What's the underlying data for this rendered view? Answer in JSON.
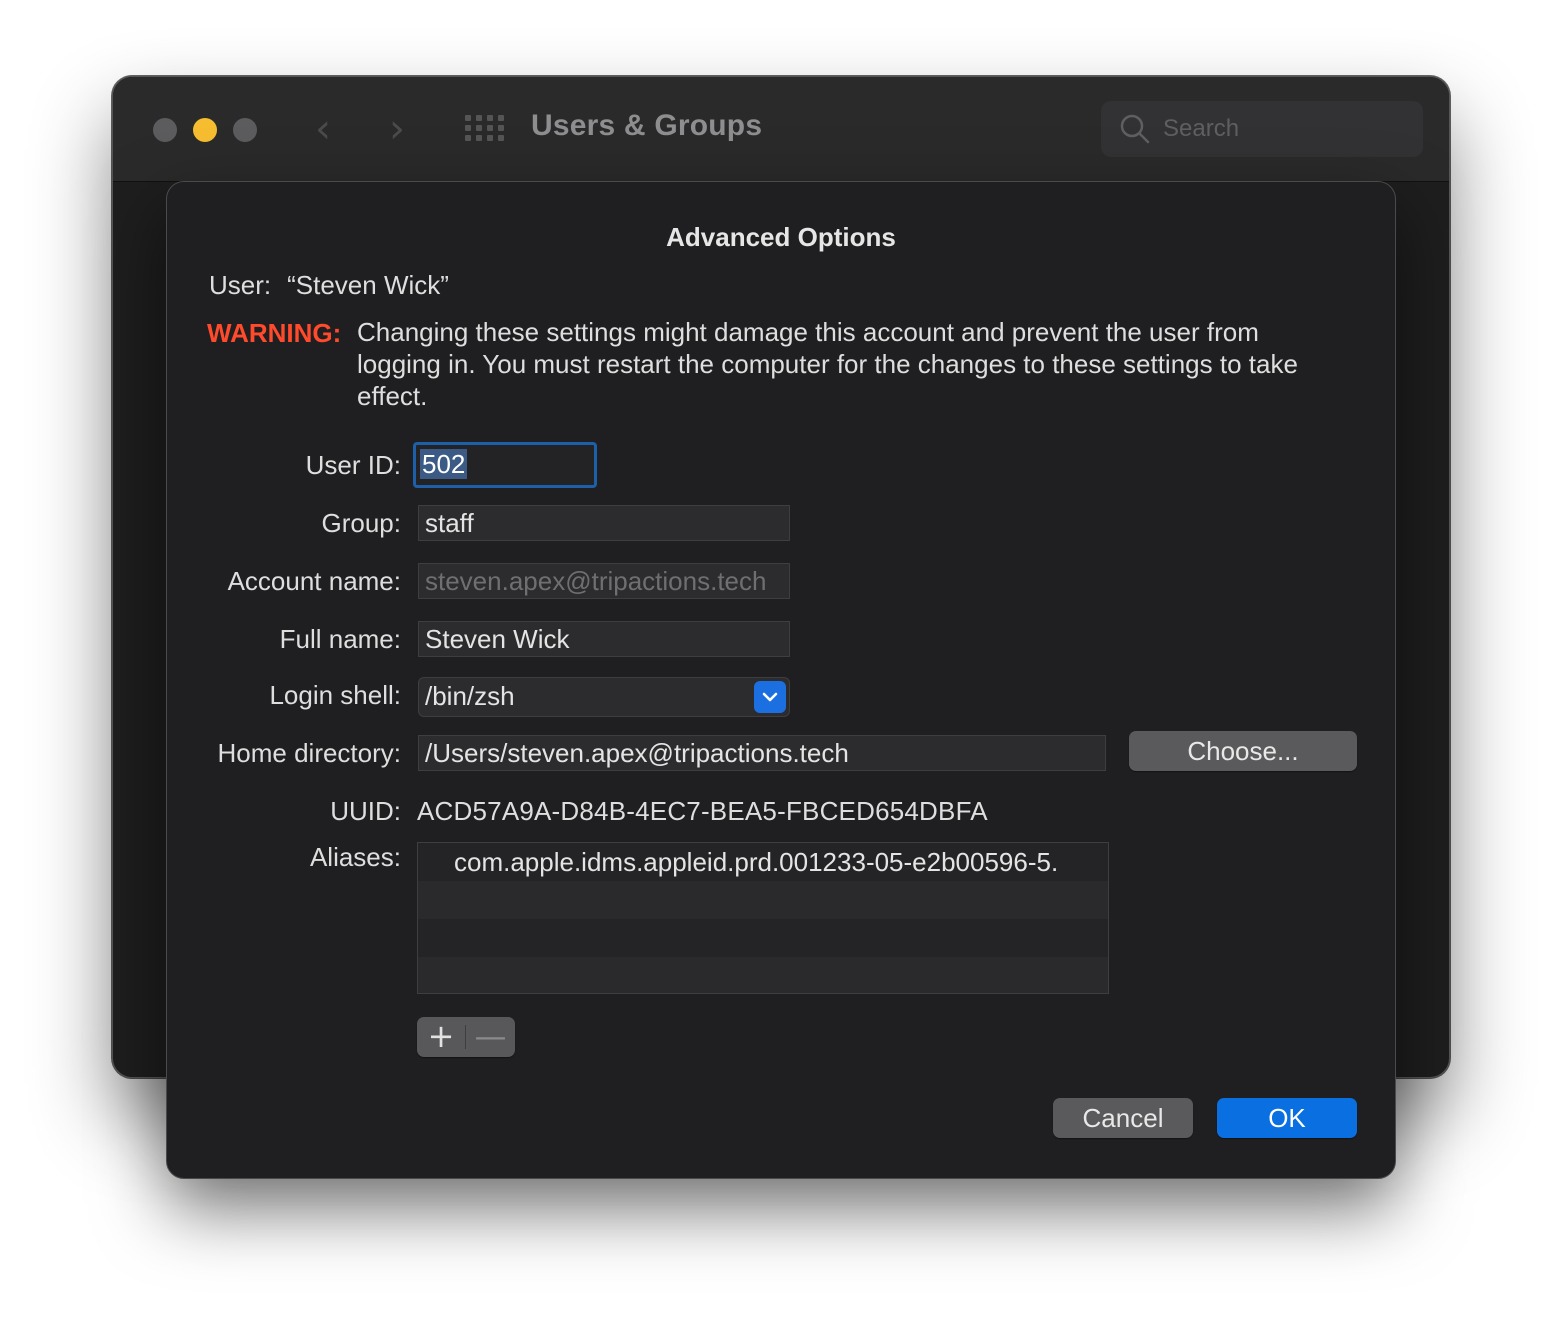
{
  "window": {
    "title": "Users & Groups",
    "search_placeholder": "Search"
  },
  "dialog": {
    "title": "Advanced Options",
    "user_label": "User:",
    "user_value": "“Steven Wick”",
    "warning_label": "WARNING:",
    "warning_text": "Changing these settings might damage this account and prevent the user from logging in. You must restart the computer for the changes to these settings to take effect.",
    "fields": {
      "user_id": {
        "label": "User ID:",
        "value": "502"
      },
      "group": {
        "label": "Group:",
        "value": "staff"
      },
      "account_name": {
        "label": "Account name:",
        "value": "steven.apex@tripactions.tech"
      },
      "full_name": {
        "label": "Full name:",
        "value": "Steven Wick"
      },
      "login_shell": {
        "label": "Login shell:",
        "value": "/bin/zsh"
      },
      "home_directory": {
        "label": "Home directory:",
        "value": "/Users/steven.apex@tripactions.tech"
      },
      "uuid": {
        "label": "UUID:",
        "value": "ACD57A9A-D84B-4EC7-BEA5-FBCED654DBFA"
      },
      "aliases": {
        "label": "Aliases:",
        "items": [
          "com.apple.idms.appleid.prd.001233-05-e2b00596-5."
        ]
      }
    },
    "choose_button": "Choose...",
    "add_symbol": "+",
    "remove_symbol": "—",
    "cancel_button": "Cancel",
    "ok_button": "OK"
  },
  "colors": {
    "accent": "#0a6fe0",
    "warning": "#ff4a2c",
    "traffic_minimize": "#f5bd2f"
  }
}
